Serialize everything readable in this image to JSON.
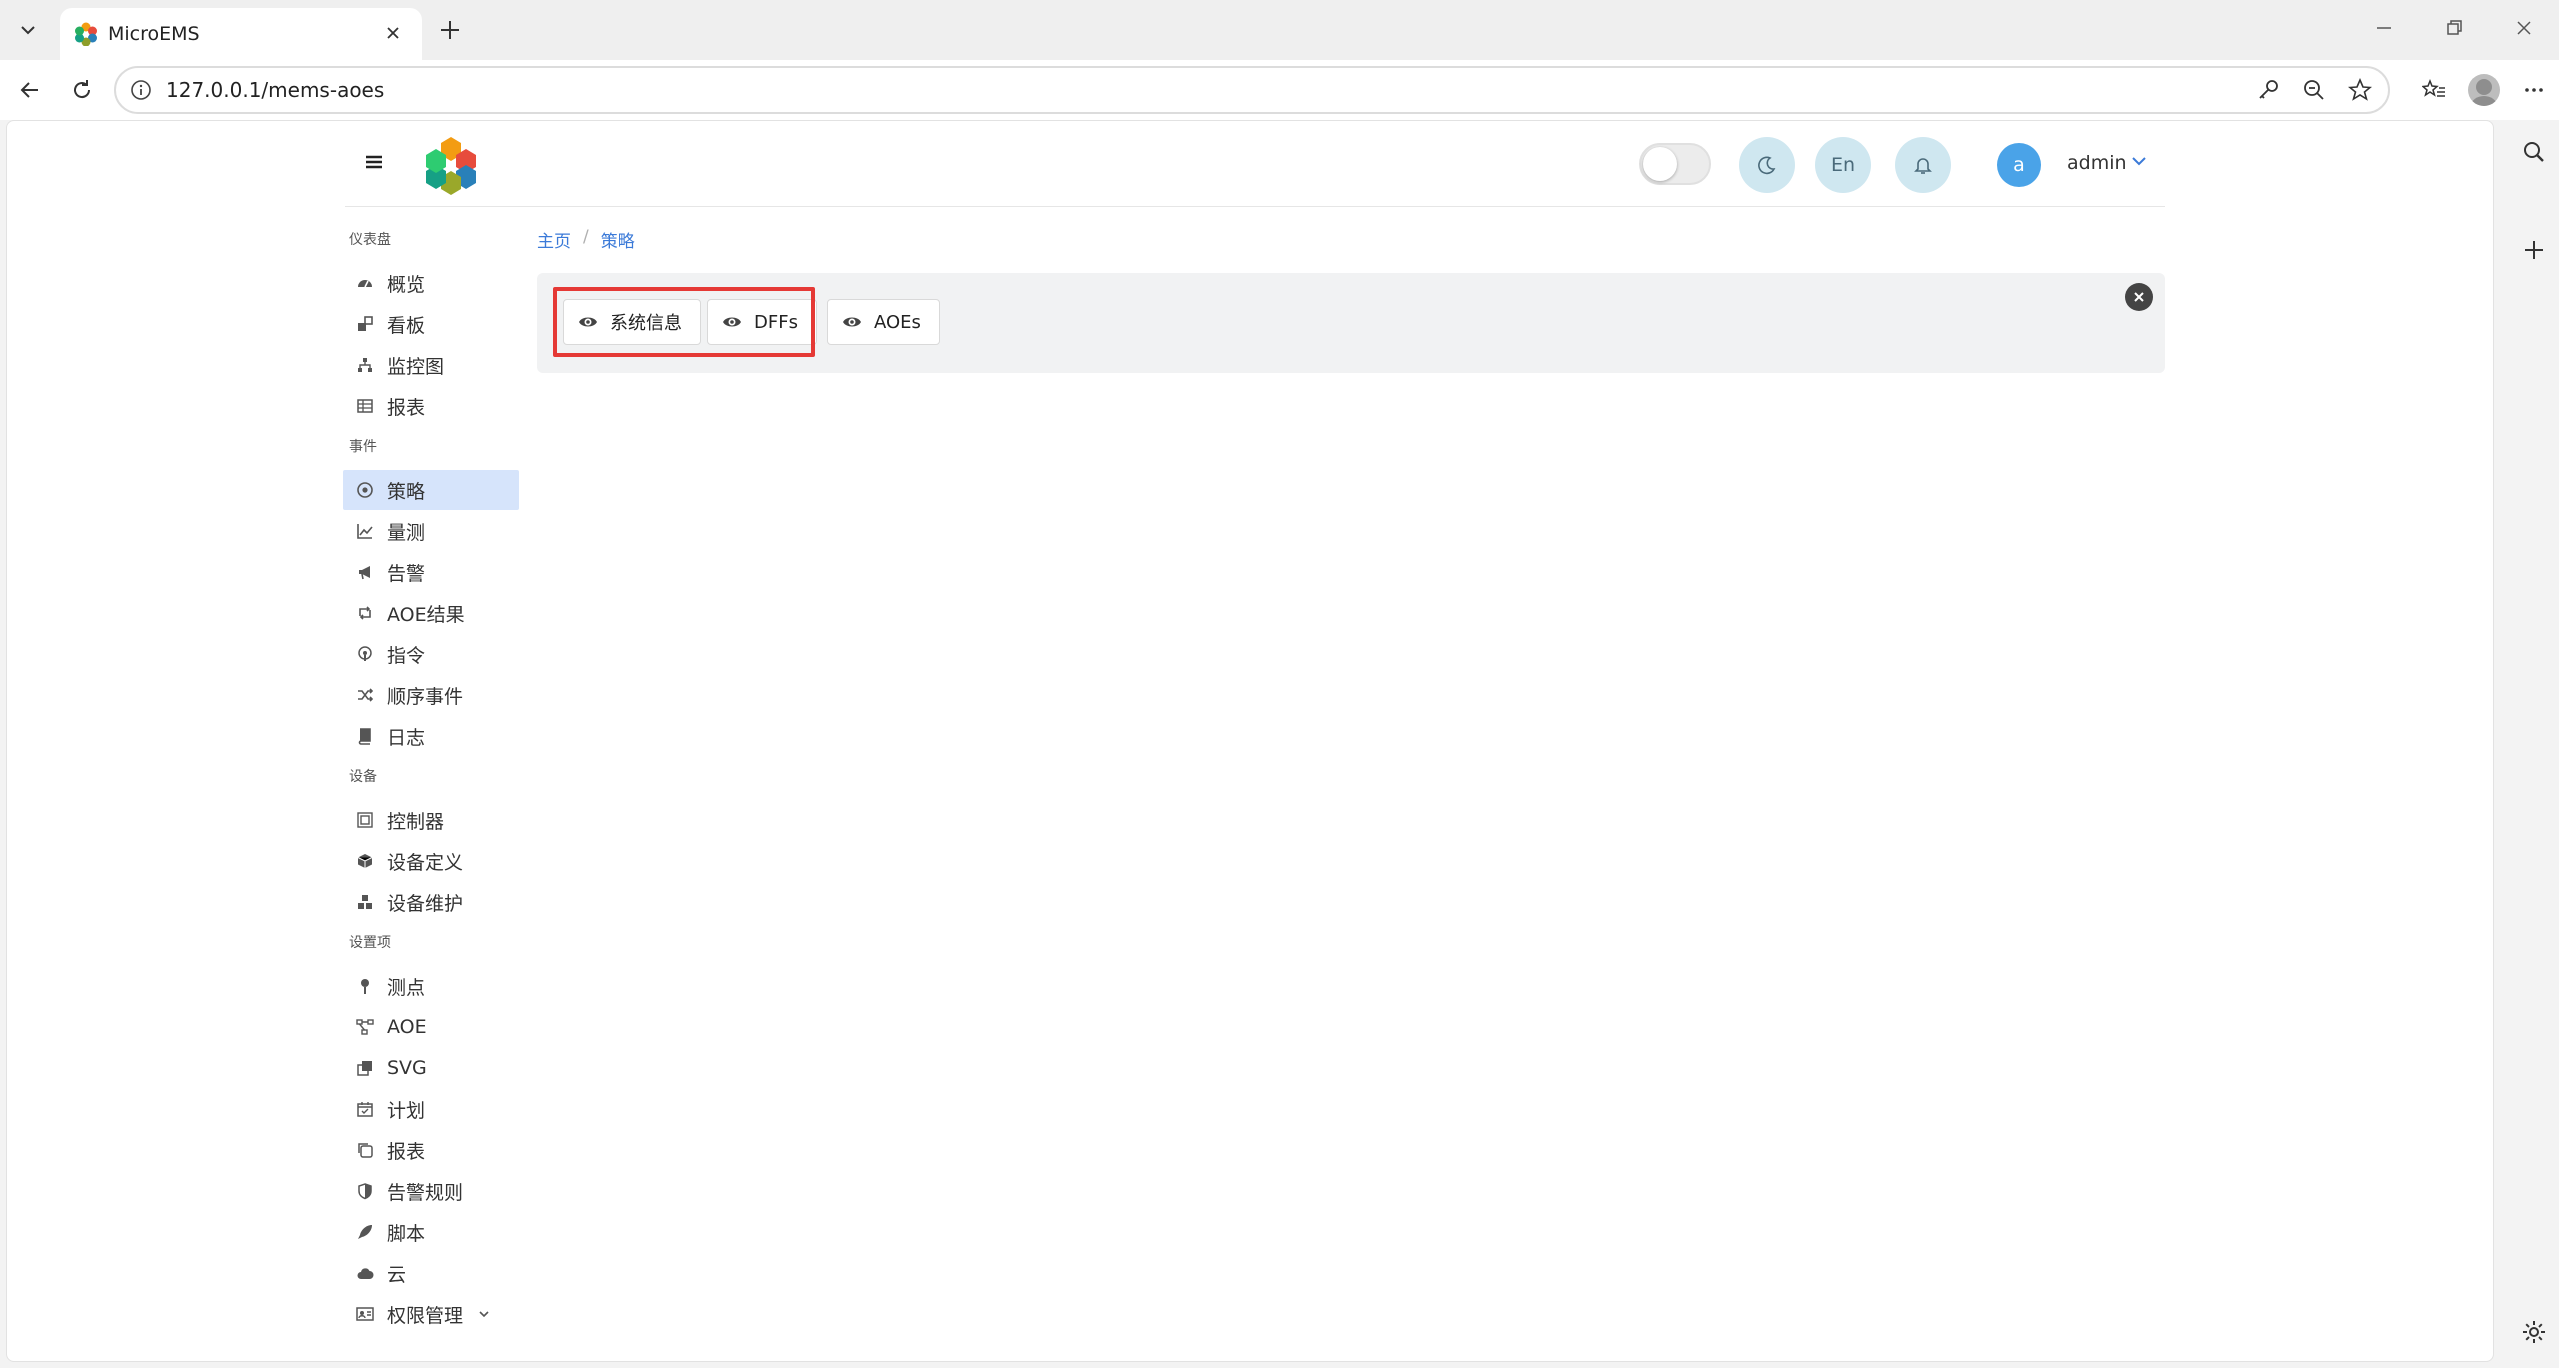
{
  "browser": {
    "tab_title": "MicroEMS",
    "url": "127.0.0.1/mems-aoes"
  },
  "header": {
    "lang_button": "En",
    "avatar_letter": "a",
    "username": "admin"
  },
  "sidebar": {
    "sections": [
      {
        "title": "仪表盘",
        "items": [
          "概览",
          "看板",
          "监控图",
          "报表"
        ]
      },
      {
        "title": "事件",
        "items": [
          "策略",
          "量测",
          "告警",
          "AOE结果",
          "指令",
          "顺序事件",
          "日志"
        ]
      },
      {
        "title": "设备",
        "items": [
          "控制器",
          "设备定义",
          "设备维护"
        ]
      },
      {
        "title": "设置项",
        "items": [
          "测点",
          "AOE",
          "SVG",
          "计划",
          "报表",
          "告警规则",
          "脚本",
          "云",
          "权限管理"
        ]
      }
    ],
    "active_item": "策略"
  },
  "breadcrumb": {
    "home": "主页",
    "separator": "/",
    "current": "策略"
  },
  "toolbar": {
    "buttons": [
      "系统信息",
      "DFFs",
      "AOEs"
    ]
  },
  "colors": {
    "accent": "#3b7ad8",
    "active_bg": "#d6e4fb",
    "highlight": "#e53935",
    "circle_btn": "#cfe7f0",
    "avatar": "#4aa3e8"
  }
}
